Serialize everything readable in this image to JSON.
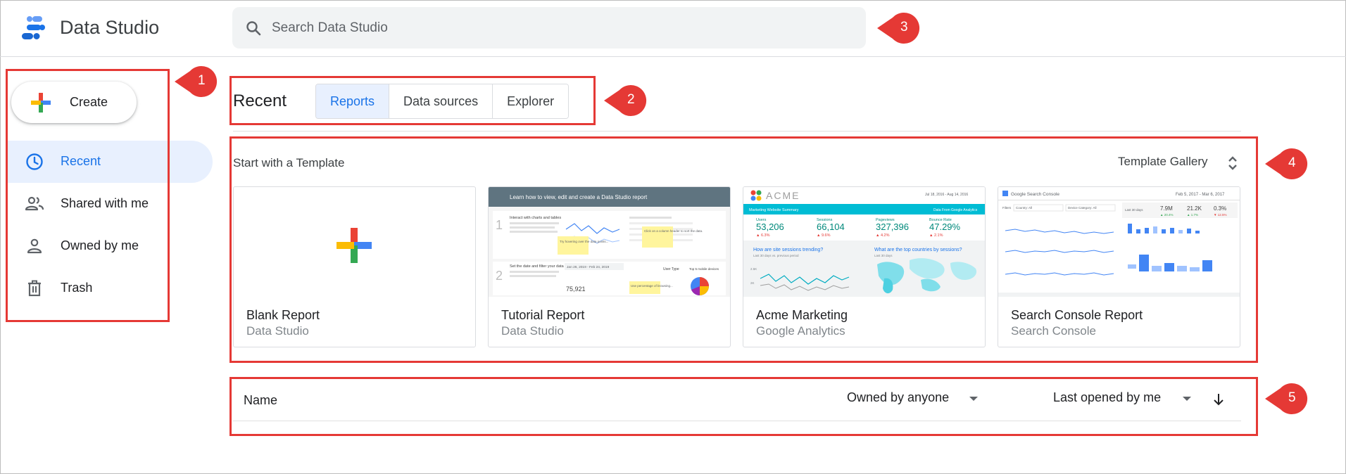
{
  "header": {
    "app_title": "Data Studio",
    "search": {
      "placeholder": "Search Data Studio",
      "value": "",
      "icon": "search-icon"
    }
  },
  "sidebar": {
    "create_label": "Create",
    "items": [
      {
        "label": "Recent",
        "icon": "clock-icon",
        "active": true
      },
      {
        "label": "Shared with me",
        "icon": "people-icon",
        "active": false
      },
      {
        "label": "Owned by me",
        "icon": "person-icon",
        "active": false
      },
      {
        "label": "Trash",
        "icon": "trash-icon",
        "active": false
      }
    ]
  },
  "recent": {
    "title": "Recent",
    "tabs": [
      {
        "label": "Reports",
        "active": true
      },
      {
        "label": "Data sources",
        "active": false
      },
      {
        "label": "Explorer",
        "active": false
      }
    ]
  },
  "templates": {
    "heading": "Start with a Template",
    "gallery_label": "Template Gallery",
    "cards": [
      {
        "title": "Blank Report",
        "subtitle": "Data Studio"
      },
      {
        "title": "Tutorial Report",
        "subtitle": "Data Studio",
        "thumb": {
          "banner": "Learn how to view, edit and create a Data Studio report",
          "step1_title": "Interact with charts and tables",
          "step2_title": "Set the date and filter your data",
          "step_numbers": [
            "1",
            "2"
          ],
          "date_range": "Jan 26, 2019 - Feb 24, 2019",
          "kpi_value": "75,921",
          "note1": "Try hovering over the data points...",
          "note2": "Click on a column header to sort the data.",
          "note3": "Use percentage of browsing...",
          "user_type_label": "User Type",
          "top_devices_label": "Top 5 mobile devices"
        }
      },
      {
        "title": "Acme Marketing",
        "subtitle": "Google Analytics",
        "thumb": {
          "brand": "ACME",
          "date_range": "Jul 18, 2016 - Aug 14, 2016",
          "banner_left": "Marketing Website Summary",
          "banner_right": "Data From Google Analytics",
          "kpis": [
            {
              "label": "Users",
              "value": "53,206",
              "delta": "▲ 6.3%"
            },
            {
              "label": "Sessions",
              "value": "66,104",
              "delta": "▲ 9.6%"
            },
            {
              "label": "Pageviews",
              "value": "327,396",
              "delta": "▲ 4.2%"
            },
            {
              "label": "Bounce Rate",
              "value": "47.29%",
              "delta": "▲ 2.1%"
            }
          ],
          "q1": "How are site sessions trending?",
          "q1_sub": "Last 30 days vs. previous period",
          "q2": "What are the top countries by sessions?",
          "q2_sub": "Last 30 days",
          "axis_labels": [
            "2.5K",
            "2K"
          ]
        }
      },
      {
        "title": "Search Console Report",
        "subtitle": "Search Console",
        "thumb": {
          "brand": "Google Search Console",
          "date_range": "Feb 5, 2017 - Mar 6, 2017",
          "filter_label": "Filters",
          "filter1": "Country: All",
          "filter2": "Device Category: All",
          "period_label": "Last 30 days",
          "kpi_values": [
            "7.9M",
            "21.2K",
            "0.3%"
          ],
          "kpi_deltas": [
            "▲ 20.4%",
            "▲ 1.7%",
            "▼ 12.5%"
          ]
        }
      }
    ]
  },
  "list": {
    "name_label": "Name",
    "owner_filter": "Owned by anyone",
    "sort_label": "Last opened by me",
    "sort_icon": "arrow-down-icon"
  },
  "callouts": [
    "1",
    "2",
    "3",
    "4",
    "5"
  ],
  "colors": {
    "accent_blue": "#1a73e8",
    "active_bg": "#e8f0fe",
    "highlight_red": "#e53935",
    "google_red": "#ea4335",
    "google_yellow": "#fbbc04",
    "google_green": "#34a853",
    "google_blue": "#4285f4"
  }
}
